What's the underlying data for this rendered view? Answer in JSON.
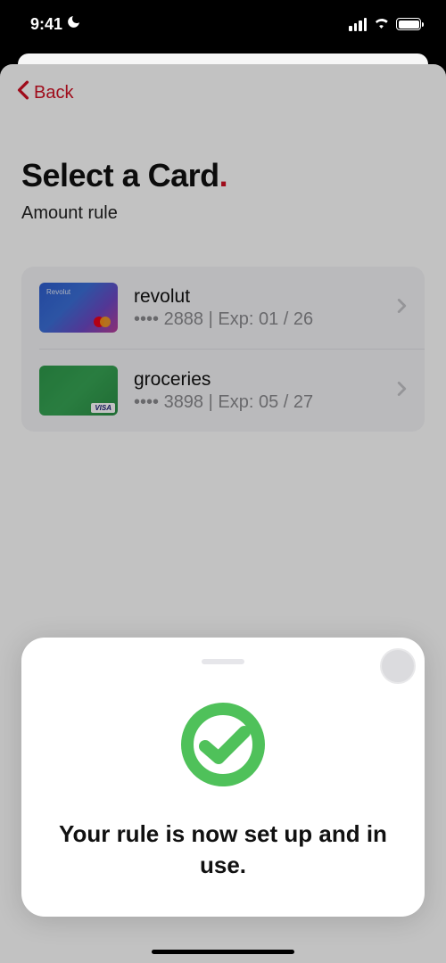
{
  "status": {
    "time": "9:41"
  },
  "nav": {
    "back_label": "Back"
  },
  "header": {
    "title": "Select a Card",
    "subtitle": "Amount rule"
  },
  "cards": [
    {
      "name": "revolut",
      "detail": "•••• 2888 | Exp: 01 / 26"
    },
    {
      "name": "groceries",
      "detail": "•••• 3898 | Exp: 05 / 27"
    }
  ],
  "sheet": {
    "message": "Your rule is now set up and in use."
  }
}
